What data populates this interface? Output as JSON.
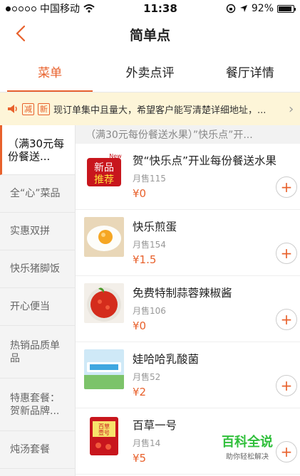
{
  "status_bar": {
    "carrier": "中国移动",
    "time": "11:38",
    "battery": "92%",
    "battery_level": 0.92
  },
  "header": {
    "title": "简单点"
  },
  "tabs": [
    {
      "label": "菜单",
      "active": true
    },
    {
      "label": "外卖点评",
      "active": false
    },
    {
      "label": "餐厅详情",
      "active": false
    }
  ],
  "notice": {
    "tags": [
      "减",
      "新"
    ],
    "text": "现订单集中且量大，希望客户能写清楚详细地址，..."
  },
  "sidebar": {
    "items": [
      {
        "label": "（满30元每份餐送...",
        "active": true
      },
      {
        "label": "全“心”菜品"
      },
      {
        "label": "实惠双拼"
      },
      {
        "label": "快乐猪脚饭"
      },
      {
        "label": "开心便当"
      },
      {
        "label": "热销品质单品"
      },
      {
        "label": "特惠套餐：贺新品牌..."
      },
      {
        "label": "炖汤套餐"
      }
    ]
  },
  "section_title": "（满30元每份餐送水果）”快乐点”开...",
  "menu_items": [
    {
      "name": "贺“快乐点”开业每份餐送水果",
      "sales": "月售115",
      "price": "¥0",
      "image_text": [
        "新品",
        "推荐",
        "New"
      ]
    },
    {
      "name": "快乐煎蛋",
      "sales": "月售154",
      "price": "¥1.5"
    },
    {
      "name": "免费特制蒜蓉辣椒酱",
      "sales": "月售106",
      "price": "¥0"
    },
    {
      "name": "娃哈哈乳酸菌",
      "sales": "月售52",
      "price": "¥2"
    },
    {
      "name": "百草一号",
      "sales": "月售14",
      "price": "¥5",
      "image_text": "百草壹号"
    }
  ],
  "watermark": {
    "title": "百科全说",
    "subtitle": "助你轻松解决"
  },
  "colors": {
    "accent": "#e8612c",
    "notice_bg": "#fdf5d8"
  }
}
